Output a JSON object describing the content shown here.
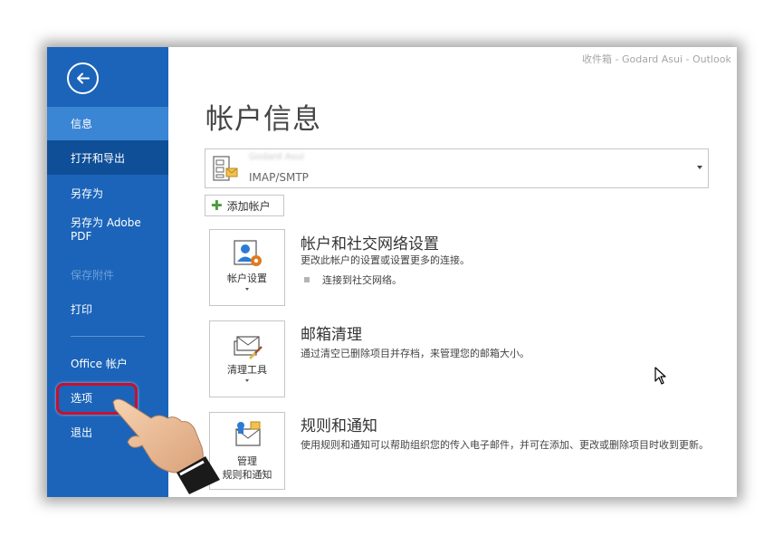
{
  "window": {
    "title": "收件箱 - Godard Asui - Outlook"
  },
  "sidebar": {
    "items": [
      {
        "label": "信息",
        "state": "active"
      },
      {
        "label": "打开和导出",
        "state": "dark"
      },
      {
        "label": "另存为",
        "state": "normal"
      },
      {
        "label": "另存为 Adobe PDF",
        "state": "normal"
      },
      {
        "label": "保存附件",
        "state": "disabled"
      },
      {
        "label": "打印",
        "state": "normal"
      },
      {
        "label": "Office 帐户",
        "state": "normal"
      },
      {
        "label": "选项",
        "state": "highlighted"
      },
      {
        "label": "退出",
        "state": "normal"
      }
    ]
  },
  "main": {
    "title": "帐户信息",
    "account_selector": {
      "name": "Godard Asui",
      "type": "IMAP/SMTP"
    },
    "add_account_label": "添加帐户",
    "sections": [
      {
        "tile_label": "帐户设置",
        "title": "帐户和社交网络设置",
        "description": "更改此帐户的设置或设置更多的连接。",
        "bullet": "连接到社交网络。"
      },
      {
        "tile_label": "清理工具",
        "title": "邮箱清理",
        "description": "通过清空已删除项目并存档，来管理您的邮箱大小。"
      },
      {
        "tile_label_line1": "管理",
        "tile_label_line2": "规则和通知",
        "title": "规则和通知",
        "description": "使用规则和通知可以帮助组织您的传入电子邮件，并可在添加、更改或删除项目时收到更新。"
      }
    ]
  },
  "colors": {
    "sidebar_bg": "#1b64b9",
    "sidebar_active": "#3a85d4",
    "sidebar_dark": "#0f4f98",
    "highlight_ring": "#c8102e"
  },
  "icons": [
    "back-arrow-icon",
    "account-card-icon",
    "account-settings-icon",
    "cleanup-tools-icon",
    "rules-alerts-icon",
    "plus-icon",
    "mouse-cursor-icon",
    "pointing-hand-icon"
  ]
}
